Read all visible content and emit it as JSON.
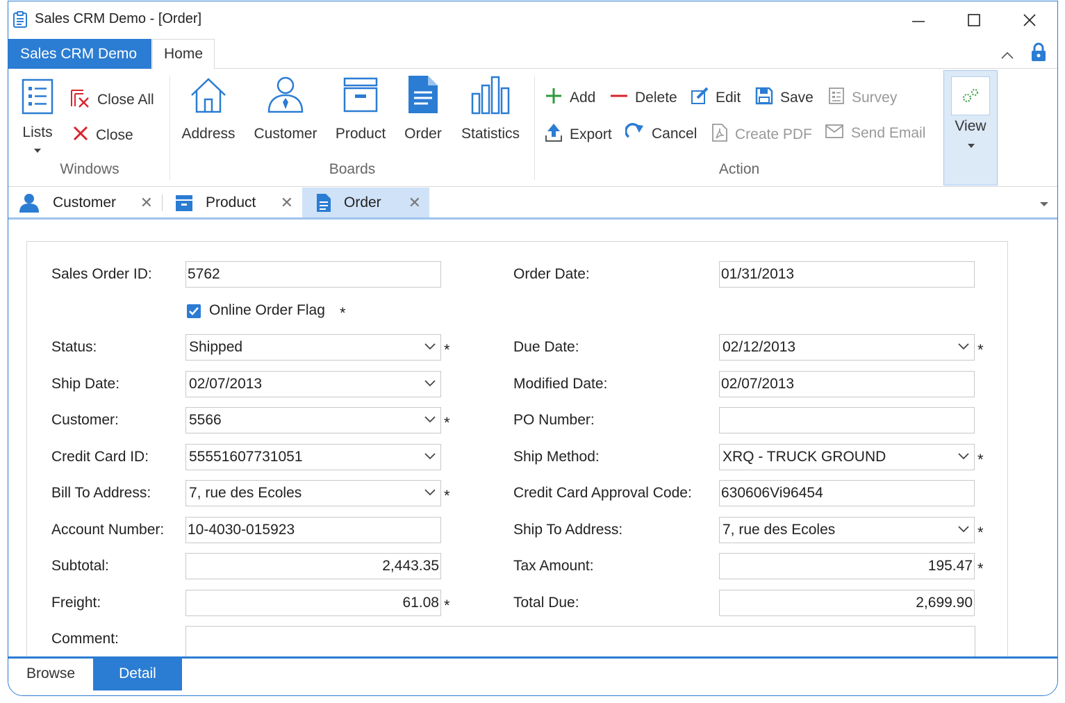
{
  "window": {
    "title": "Sales CRM Demo - [Order]"
  },
  "ribbon_tabs": {
    "app": "Sales CRM Demo",
    "home": "Home"
  },
  "windows_group": {
    "label": "Windows",
    "lists": "Lists",
    "close_all": "Close All",
    "close": "Close"
  },
  "boards_group": {
    "label": "Boards",
    "address": "Address",
    "customer": "Customer",
    "product": "Product",
    "order": "Order",
    "statistics": "Statistics"
  },
  "action_group": {
    "label": "Action",
    "add": "Add",
    "delete": "Delete",
    "edit": "Edit",
    "save": "Save",
    "survey": "Survey",
    "export": "Export",
    "cancel": "Cancel",
    "create_pdf": "Create PDF",
    "send_email": "Send Email"
  },
  "view": {
    "label": "View"
  },
  "doc_tabs": [
    {
      "label": "Customer"
    },
    {
      "label": "Product"
    },
    {
      "label": "Order"
    }
  ],
  "form": {
    "sales_order_id": {
      "label": "Sales Order ID:",
      "value": "5762"
    },
    "online_order_flag": {
      "label": "Online Order Flag",
      "checked": true
    },
    "status": {
      "label": "Status:",
      "value": "Shipped"
    },
    "ship_date": {
      "label": "Ship Date:",
      "value": "02/07/2013"
    },
    "customer": {
      "label": "Customer:",
      "value": "5566"
    },
    "credit_card_id": {
      "label": "Credit Card ID:",
      "value": "55551607731051"
    },
    "bill_to_address": {
      "label": "Bill To Address:",
      "value": "7, rue des Ecoles"
    },
    "account_number": {
      "label": "Account Number:",
      "value": "10-4030-015923"
    },
    "subtotal": {
      "label": "Subtotal:",
      "value": "2,443.35"
    },
    "freight": {
      "label": "Freight:",
      "value": "61.08"
    },
    "comment": {
      "label": "Comment:",
      "value": ""
    },
    "order_date": {
      "label": "Order Date:",
      "value": "01/31/2013"
    },
    "due_date": {
      "label": "Due Date:",
      "value": "02/12/2013"
    },
    "modified_date": {
      "label": "Modified Date:",
      "value": "02/07/2013"
    },
    "po_number": {
      "label": "PO Number:",
      "value": ""
    },
    "ship_method": {
      "label": "Ship Method:",
      "value": "XRQ - TRUCK GROUND"
    },
    "cc_approval_code": {
      "label": "Credit Card Approval Code:",
      "value": "630606Vi96454"
    },
    "ship_to_address": {
      "label": "Ship To Address:",
      "value": "7, rue des Ecoles"
    },
    "tax_amount": {
      "label": "Tax Amount:",
      "value": "195.47"
    },
    "total_due": {
      "label": "Total Due:",
      "value": "2,699.90"
    },
    "required_marker": "*"
  },
  "bottom_tabs": {
    "browse": "Browse",
    "detail": "Detail"
  },
  "colors": {
    "accent": "#2b7cd3",
    "delete_red": "#d9232d",
    "add_green": "#2e9b3a"
  }
}
